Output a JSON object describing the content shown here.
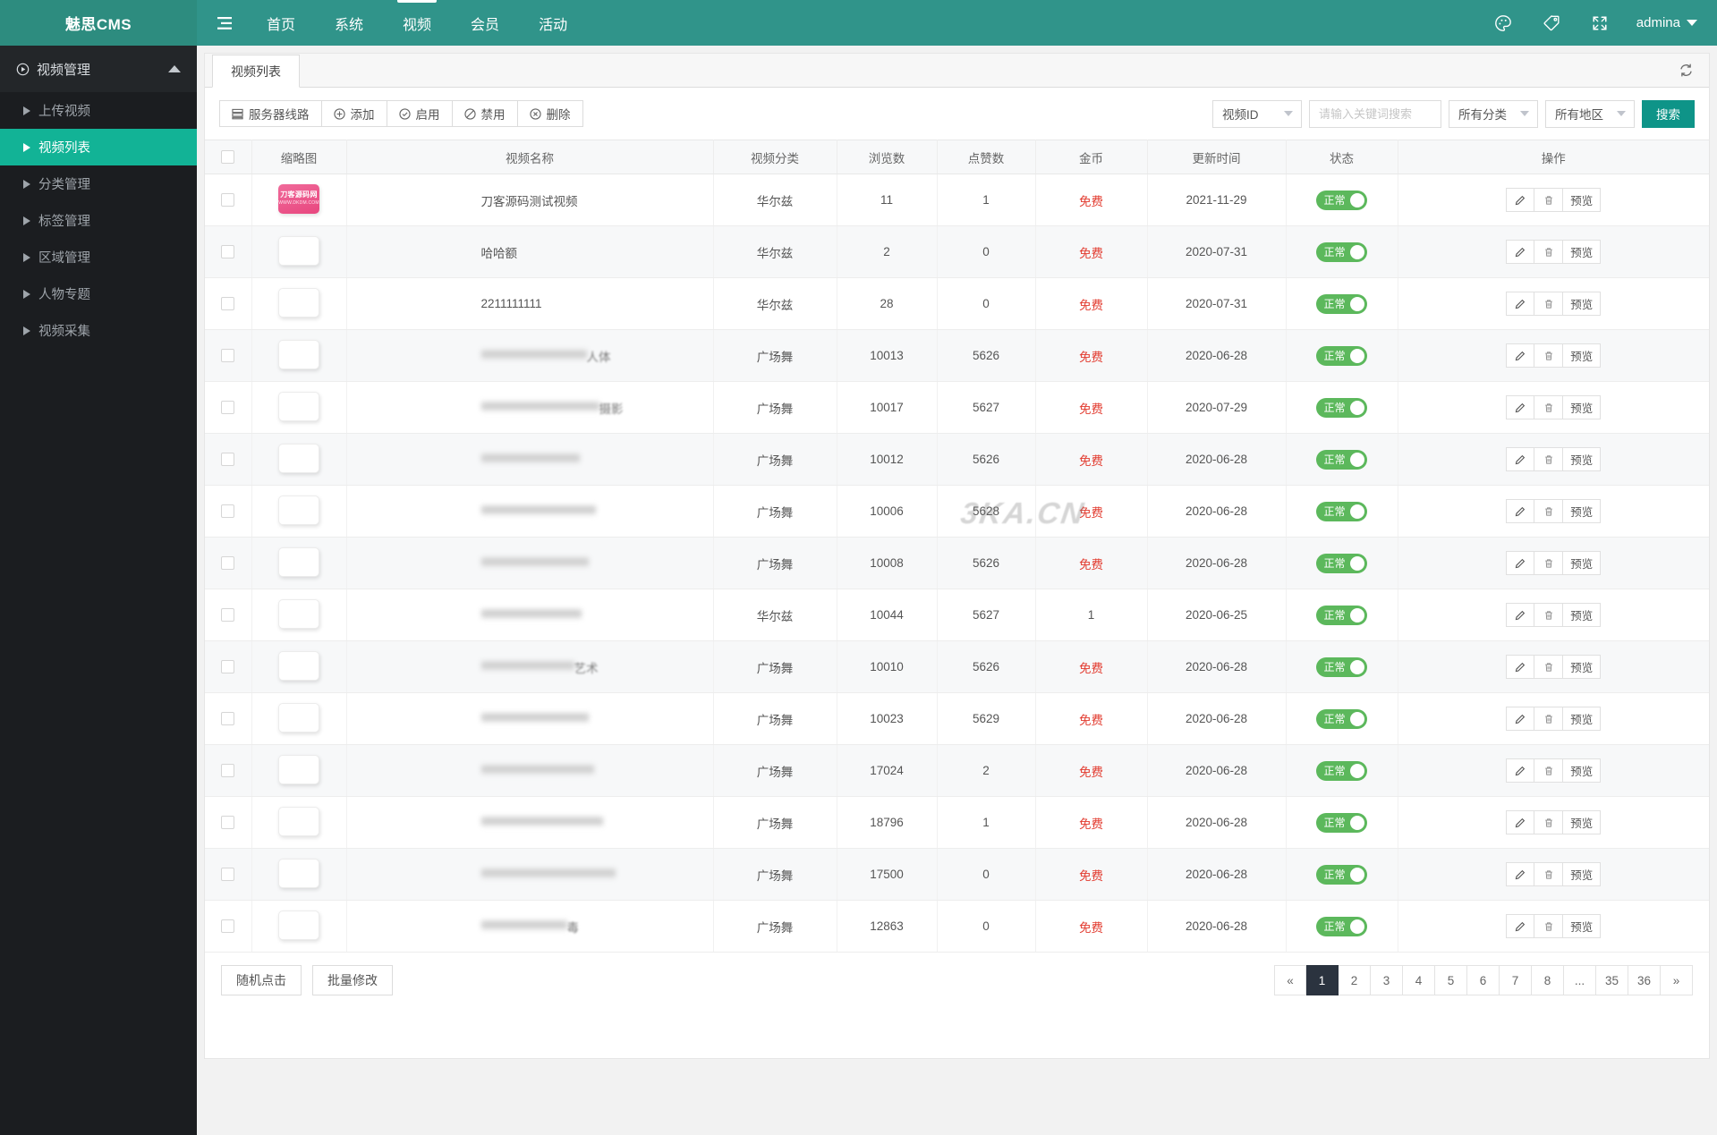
{
  "brand": {
    "name": "魅思CMS"
  },
  "topnav": {
    "menu_icon": "hamburger-icon",
    "items": [
      {
        "label": "首页",
        "active": false
      },
      {
        "label": "系统",
        "active": false
      },
      {
        "label": "视频",
        "active": true
      },
      {
        "label": "会员",
        "active": false
      },
      {
        "label": "活动",
        "active": false
      }
    ],
    "icons": [
      "palette-icon",
      "tag-icon",
      "fullscreen-icon"
    ],
    "user": "admina"
  },
  "sidebar": {
    "group": {
      "label": "视频管理",
      "icon": "play-circle-icon",
      "collapse_icon": "chevron-up-icon"
    },
    "items": [
      {
        "label": "上传视频",
        "active": false
      },
      {
        "label": "视频列表",
        "active": true
      },
      {
        "label": "分类管理",
        "active": false
      },
      {
        "label": "标签管理",
        "active": false
      },
      {
        "label": "区域管理",
        "active": false
      },
      {
        "label": "人物专题",
        "active": false
      },
      {
        "label": "视频采集",
        "active": false
      }
    ]
  },
  "tab": {
    "label": "视频列表",
    "refresh_icon": "refresh-icon"
  },
  "toolbar": {
    "buttons": [
      {
        "label": "服务器线路",
        "icon": "server-icon"
      },
      {
        "label": "添加",
        "icon": "plus-circle-icon"
      },
      {
        "label": "启用",
        "icon": "check-circle-icon"
      },
      {
        "label": "禁用",
        "icon": "ban-circle-icon"
      },
      {
        "label": "删除",
        "icon": "x-circle-icon"
      }
    ],
    "field_select": "视频ID",
    "keyword_placeholder": "请输入关键词搜索",
    "keyword_value": "",
    "category_select": "所有分类",
    "region_select": "所有地区",
    "search_label": "搜索",
    "search_color": "#0e9488"
  },
  "table": {
    "headers": [
      "",
      "缩略图",
      "视频名称",
      "视频分类",
      "浏览数",
      "点赞数",
      "金币",
      "更新时间",
      "状态",
      "操作"
    ],
    "rows": [
      {
        "thumb": "brand",
        "name": "刀客源码测试视频",
        "blur": false,
        "category": "华尔兹",
        "views": "11",
        "likes": "1",
        "coin": "免费",
        "updated": "2021-11-29",
        "status": "正常"
      },
      {
        "thumb": "blank",
        "name": "哈哈额",
        "blur": false,
        "category": "华尔兹",
        "views": "2",
        "likes": "0",
        "coin": "免费",
        "updated": "2020-07-31",
        "status": "正常"
      },
      {
        "thumb": "blank",
        "name": "2211111111",
        "blur": false,
        "category": "华尔兹",
        "views": "28",
        "likes": "0",
        "coin": "免费",
        "updated": "2020-07-31",
        "status": "正常"
      },
      {
        "thumb": "blank",
        "name": "人体",
        "blur": true,
        "category": "广场舞",
        "views": "10013",
        "likes": "5626",
        "coin": "免费",
        "updated": "2020-06-28",
        "status": "正常"
      },
      {
        "thumb": "blank",
        "name": "摄影",
        "blur": true,
        "category": "广场舞",
        "views": "10017",
        "likes": "5627",
        "coin": "免费",
        "updated": "2020-07-29",
        "status": "正常"
      },
      {
        "thumb": "blank",
        "name": "",
        "blur": true,
        "category": "广场舞",
        "views": "10012",
        "likes": "5626",
        "coin": "免费",
        "updated": "2020-06-28",
        "status": "正常"
      },
      {
        "thumb": "blank",
        "name": "",
        "blur": true,
        "category": "广场舞",
        "views": "10006",
        "likes": "5628",
        "coin": "免费",
        "updated": "2020-06-28",
        "status": "正常"
      },
      {
        "thumb": "blank",
        "name": "",
        "blur": true,
        "category": "广场舞",
        "views": "10008",
        "likes": "5626",
        "coin": "免费",
        "updated": "2020-06-28",
        "status": "正常"
      },
      {
        "thumb": "blank",
        "name": "",
        "blur": true,
        "category": "华尔兹",
        "views": "10044",
        "likes": "5627",
        "coin": "1",
        "updated": "2020-06-25",
        "status": "正常"
      },
      {
        "thumb": "blank",
        "name": "艺术",
        "blur": true,
        "category": "广场舞",
        "views": "10010",
        "likes": "5626",
        "coin": "免费",
        "updated": "2020-06-28",
        "status": "正常"
      },
      {
        "thumb": "blank",
        "name": "",
        "blur": true,
        "category": "广场舞",
        "views": "10023",
        "likes": "5629",
        "coin": "免费",
        "updated": "2020-06-28",
        "status": "正常"
      },
      {
        "thumb": "blank",
        "name": "",
        "blur": true,
        "category": "广场舞",
        "views": "17024",
        "likes": "2",
        "coin": "免费",
        "updated": "2020-06-28",
        "status": "正常"
      },
      {
        "thumb": "blank",
        "name": "",
        "blur": true,
        "category": "广场舞",
        "views": "18796",
        "likes": "1",
        "coin": "免费",
        "updated": "2020-06-28",
        "status": "正常"
      },
      {
        "thumb": "blank",
        "name": "",
        "blur": true,
        "category": "广场舞",
        "views": "17500",
        "likes": "0",
        "coin": "免费",
        "updated": "2020-06-28",
        "status": "正常"
      },
      {
        "thumb": "blank",
        "name": "毒",
        "blur": true,
        "category": "广场舞",
        "views": "12863",
        "likes": "0",
        "coin": "免费",
        "updated": "2020-06-28",
        "status": "正常"
      }
    ],
    "row_actions": {
      "edit_icon": "pencil-icon",
      "delete_icon": "trash-icon",
      "preview_label": "预览"
    },
    "thumb_brand": {
      "line1": "刀客源码网",
      "line2": "WWW.DKDM.COM"
    }
  },
  "watermark": "3KA.CN",
  "footer": {
    "buttons": [
      "随机点击",
      "批量修改"
    ],
    "pagination": [
      "«",
      "1",
      "2",
      "3",
      "4",
      "5",
      "6",
      "7",
      "8",
      "...",
      "35",
      "36",
      "»"
    ],
    "current_page": "1"
  }
}
